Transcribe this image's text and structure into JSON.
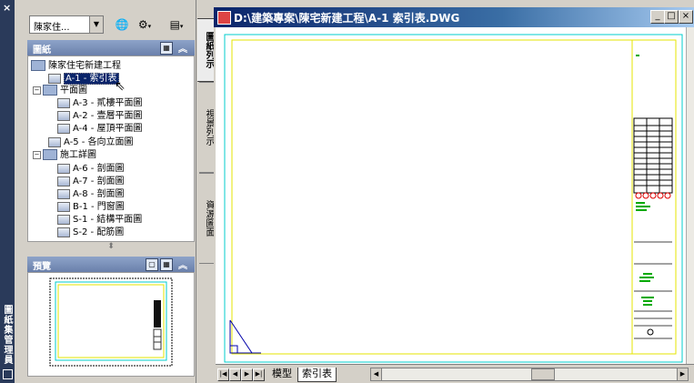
{
  "sheet_set_manager": {
    "title": "圖紙集管理員",
    "close": "×",
    "sheet_set_selector": "陳家住...",
    "panels": {
      "sheets": "圖紙",
      "preview": "預覽"
    },
    "tree": {
      "root": "陳家住宅新建工程",
      "n1": "A-1 - 索引表",
      "n2": "平面圖",
      "n3": "A-3 - 貳樓平面圖",
      "n4": "A-2 - 壹層平面圖",
      "n5": "A-4 - 屋頂平面圖",
      "n6": "A-5 - 各向立面圖",
      "n7": "施工詳圖",
      "n8": "A-6 - 剖面圖",
      "n9": "A-7 - 剖面圖",
      "n10": "A-8 - 剖面圖",
      "n11": "B-1 - 門窗圖",
      "n12": "S-1 - 結構平面圖",
      "n13": "S-2 - 配筋圖"
    },
    "tabs": {
      "sheet_list": "圖紙列示",
      "view_list": "視景列示",
      "resource_drawings": "資源圖面"
    }
  },
  "drawing_window": {
    "title": "D:\\建築專案\\陳宅新建工程\\A-1 索引表.DWG",
    "minimize": "_",
    "maximize": "□",
    "close": "×",
    "layout_tabs": {
      "model": "模型",
      "layout": "索引表"
    }
  },
  "colors": {
    "title_active": "#0a246a",
    "tree_selected": "#0a246a",
    "viewport_border": "#ffff00",
    "sheet_border": "#00cccc",
    "panel_header": "#7c92bd"
  },
  "icons": {
    "combo_arrow": "chevron-down-icon",
    "publish": "publish-icon",
    "sheet": "sheet-icon",
    "group": "folder-icon"
  }
}
